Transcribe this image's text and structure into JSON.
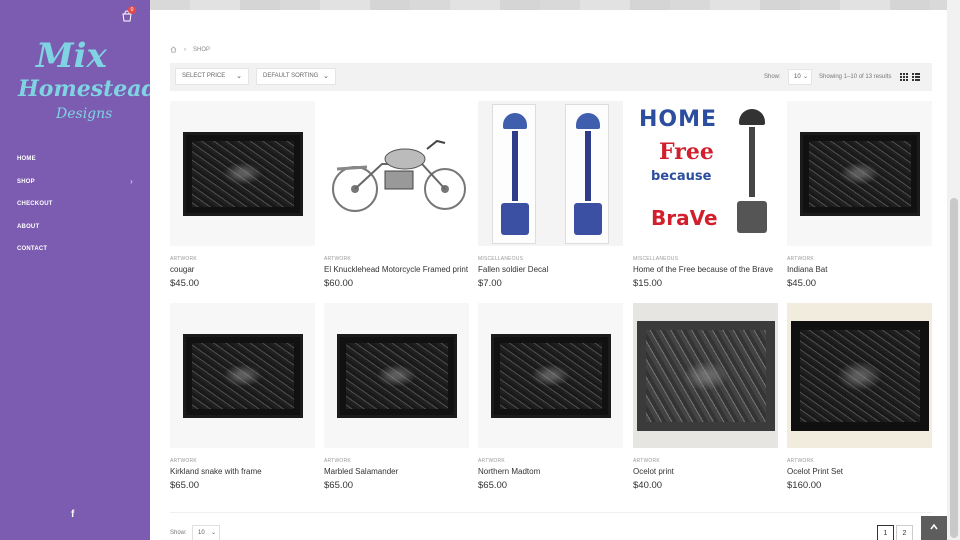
{
  "cart": {
    "count": "0"
  },
  "logo": {
    "line1": "Mix",
    "line2": "Homestead",
    "line3": "Designs"
  },
  "nav": [
    {
      "label": "HOME"
    },
    {
      "label": "SHOP",
      "chevron": "›"
    },
    {
      "label": "CHECKOUT"
    },
    {
      "label": "ABOUT"
    },
    {
      "label": "CONTACT"
    }
  ],
  "social": {
    "facebook": "f"
  },
  "breadcrumb": {
    "current": "SHOP"
  },
  "toolbar": {
    "price_filter": "SELECT PRICE",
    "sorting": "DEFAULT SORTING",
    "show_label": "Show:",
    "show_value": "10",
    "results": "Showing 1–10 of 13 results"
  },
  "products": [
    {
      "category": "ARTWORK",
      "title": "cougar",
      "price": "$45.00"
    },
    {
      "category": "ARTWORK",
      "title": "El Knucklehead Motorcycle Framed print",
      "price": "$60.00"
    },
    {
      "category": "MISCELLANEOUS",
      "title": "Fallen soldier Decal",
      "price": "$7.00"
    },
    {
      "category": "MISCELLANEOUS",
      "title": "Home of the Free because of the Brave",
      "price": "$15.00"
    },
    {
      "category": "ARTWORK",
      "title": "Indiana Bat",
      "price": "$45.00"
    },
    {
      "category": "ARTWORK",
      "title": "Kirkland snake with frame",
      "price": "$65.00"
    },
    {
      "category": "ARTWORK",
      "title": "Marbled Salamander",
      "price": "$65.00"
    },
    {
      "category": "ARTWORK",
      "title": "Northern Madtom",
      "price": "$65.00"
    },
    {
      "category": "ARTWORK",
      "title": "Ocelot print",
      "price": "$40.00"
    },
    {
      "category": "ARTWORK",
      "title": "Ocelot Print Set",
      "price": "$160.00"
    }
  ],
  "decal_text": {
    "home": "HOME",
    "free": "Free",
    "because": "because",
    "brave": "BraVe"
  },
  "footer": {
    "show_label": "Show:",
    "show_value": "10"
  },
  "pagination": [
    "1",
    "2"
  ],
  "icons": [
    "cart-icon",
    "home-icon",
    "grid-view-icon",
    "list-view-icon",
    "facebook-icon",
    "arrow-up-icon",
    "chevron-down-icon"
  ]
}
